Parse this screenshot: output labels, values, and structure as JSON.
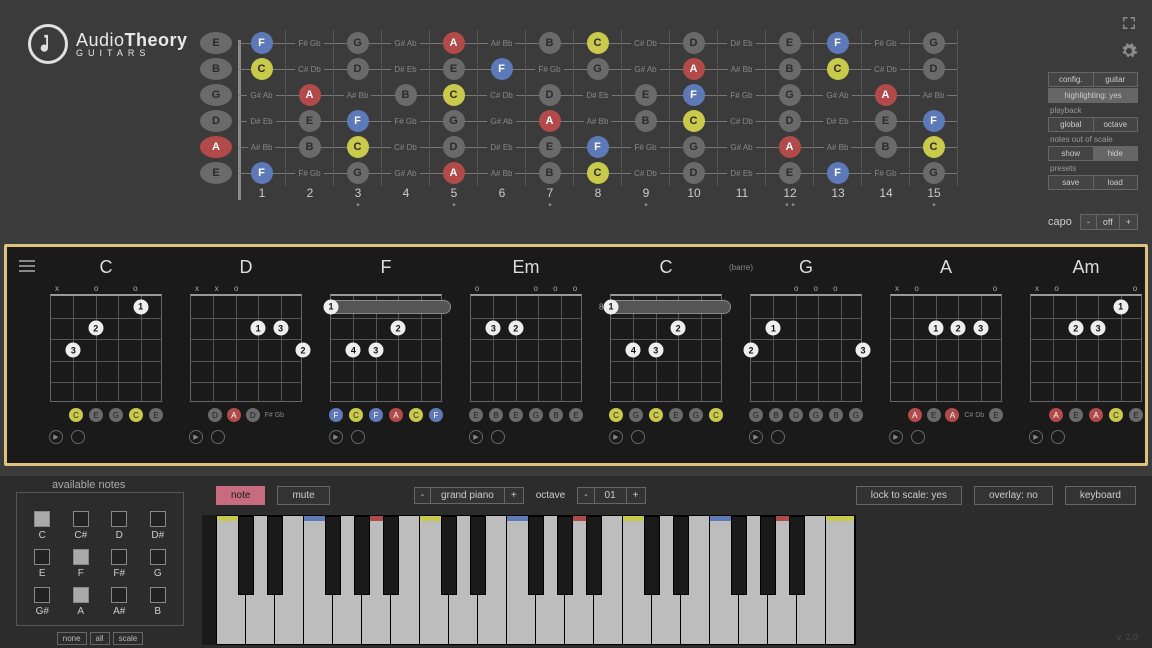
{
  "app": {
    "brand1": "Audio",
    "brand2": "Theory",
    "brand3": "GUITARS"
  },
  "settings": {
    "config": "config.",
    "guitar": "guitar",
    "highlighting": "highlighting: yes",
    "playback_hdr": "playback",
    "global": "global",
    "octave": "octave",
    "oos_hdr": "notes out of scale",
    "show": "show",
    "hide": "hide",
    "presets_hdr": "presets",
    "save": "save",
    "load": "load"
  },
  "capo": {
    "label": "capo",
    "minus": "-",
    "value": "off",
    "plus": "+"
  },
  "tuning": [
    "E",
    "B",
    "G",
    "D",
    "A",
    "E"
  ],
  "fretboard": {
    "frets": [
      "1",
      "2",
      "3",
      "4",
      "5",
      "6",
      "7",
      "8",
      "9",
      "10",
      "11",
      "12",
      "13",
      "14",
      "15"
    ],
    "dots": [
      "",
      "",
      "•",
      "",
      "•",
      "",
      "•",
      "",
      "•",
      "",
      "",
      "• •",
      "",
      "",
      "•"
    ],
    "rows": [
      [
        [
          "F",
          "b"
        ],
        [
          "F# Gb",
          ""
        ],
        [
          "G",
          "g"
        ],
        [
          "G# Ab",
          ""
        ],
        [
          "A",
          "r"
        ],
        [
          "A# Bb",
          ""
        ],
        [
          "B",
          "g"
        ],
        [
          "C",
          "y"
        ],
        [
          "C# Db",
          ""
        ],
        [
          "D",
          "g"
        ],
        [
          "D# Eb",
          ""
        ],
        [
          "E",
          "g"
        ],
        [
          "F",
          "b"
        ],
        [
          "F# Gb",
          ""
        ],
        [
          "G",
          "g"
        ]
      ],
      [
        [
          "C",
          "y"
        ],
        [
          "C# Db",
          ""
        ],
        [
          "D",
          "g"
        ],
        [
          "D# Eb",
          ""
        ],
        [
          "E",
          "g"
        ],
        [
          "F",
          "b"
        ],
        [
          "F# Gb",
          ""
        ],
        [
          "G",
          "g"
        ],
        [
          "G# Ab",
          ""
        ],
        [
          "A",
          "r"
        ],
        [
          "A# Bb",
          ""
        ],
        [
          "B",
          "g"
        ],
        [
          "C",
          "y"
        ],
        [
          "C# Db",
          ""
        ],
        [
          "D",
          "g"
        ]
      ],
      [
        [
          "G# Ab",
          ""
        ],
        [
          "A",
          "r"
        ],
        [
          "A# Bb",
          ""
        ],
        [
          "B",
          "g"
        ],
        [
          "C",
          "y"
        ],
        [
          "C# Db",
          ""
        ],
        [
          "D",
          "g"
        ],
        [
          "D# Eb",
          ""
        ],
        [
          "E",
          "g"
        ],
        [
          "F",
          "b"
        ],
        [
          "F# Gb",
          ""
        ],
        [
          "G",
          "g"
        ],
        [
          "G# Ab",
          ""
        ],
        [
          "A",
          "r"
        ],
        [
          "A# Bb",
          ""
        ]
      ],
      [
        [
          "D# Eb",
          ""
        ],
        [
          "E",
          "g"
        ],
        [
          "F",
          "b"
        ],
        [
          "F# Gb",
          ""
        ],
        [
          "G",
          "g"
        ],
        [
          "G# Ab",
          ""
        ],
        [
          "A",
          "r"
        ],
        [
          "A# Bb",
          ""
        ],
        [
          "B",
          "g"
        ],
        [
          "C",
          "y"
        ],
        [
          "C# Db",
          ""
        ],
        [
          "D",
          "g"
        ],
        [
          "D# Eb",
          ""
        ],
        [
          "E",
          "g"
        ],
        [
          "F",
          "b"
        ]
      ],
      [
        [
          "A# Bb",
          ""
        ],
        [
          "B",
          "g"
        ],
        [
          "C",
          "y"
        ],
        [
          "C# Db",
          ""
        ],
        [
          "D",
          "g"
        ],
        [
          "D# Eb",
          ""
        ],
        [
          "E",
          "g"
        ],
        [
          "F",
          "b"
        ],
        [
          "F# Gb",
          ""
        ],
        [
          "G",
          "g"
        ],
        [
          "G# Ab",
          ""
        ],
        [
          "A",
          "r"
        ],
        [
          "A# Bb",
          ""
        ],
        [
          "B",
          "g"
        ],
        [
          "C",
          "y"
        ]
      ],
      [
        [
          "F",
          "b"
        ],
        [
          "F# Gb",
          ""
        ],
        [
          "G",
          "g"
        ],
        [
          "G# Ab",
          ""
        ],
        [
          "A",
          "r"
        ],
        [
          "A# Bb",
          ""
        ],
        [
          "B",
          "g"
        ],
        [
          "C",
          "y"
        ],
        [
          "C# Db",
          ""
        ],
        [
          "D",
          "g"
        ],
        [
          "D# Eb",
          ""
        ],
        [
          "E",
          "g"
        ],
        [
          "F",
          "b"
        ],
        [
          "F# Gb",
          ""
        ],
        [
          "G",
          "g"
        ]
      ]
    ]
  },
  "chords": [
    {
      "name": "C",
      "open": [
        "x",
        "",
        "o",
        "",
        "o",
        ""
      ],
      "dots": [
        [
          1,
          1,
          "1"
        ],
        [
          3,
          2,
          "2"
        ],
        [
          4,
          3,
          "3"
        ]
      ],
      "tones": [
        [
          "",
          ""
        ],
        [
          "C",
          "y"
        ],
        [
          "E",
          "g"
        ],
        [
          "G",
          "g"
        ],
        [
          "C",
          "y"
        ],
        [
          "E",
          "g"
        ]
      ]
    },
    {
      "name": "D",
      "open": [
        "x",
        "x",
        "o",
        "",
        "",
        ""
      ],
      "dots": [
        [
          2,
          2,
          "1"
        ],
        [
          1,
          2,
          "3"
        ],
        [
          0,
          3,
          "2"
        ]
      ],
      "tones": [
        [
          "",
          ""
        ],
        [
          "D",
          "g"
        ],
        [
          "A",
          "r"
        ],
        [
          "D",
          "g"
        ],
        [
          "F# Gb",
          "t"
        ],
        [
          "",
          ""
        ]
      ]
    },
    {
      "name": "F",
      "open": [
        "",
        "",
        "",
        "",
        "",
        ""
      ],
      "barre": {
        "fret": 1,
        "from": 0,
        "to": 5,
        "label": "1"
      },
      "dots": [
        [
          2,
          2,
          "2"
        ],
        [
          3,
          3,
          "3"
        ],
        [
          4,
          3,
          "4"
        ]
      ],
      "tones": [
        [
          "F",
          "b"
        ],
        [
          "C",
          "y"
        ],
        [
          "F",
          "b"
        ],
        [
          "A",
          "r"
        ],
        [
          "C",
          "y"
        ],
        [
          "F",
          "b"
        ]
      ]
    },
    {
      "name": "Em",
      "open": [
        "o",
        "",
        "",
        "o",
        "o",
        "o"
      ],
      "dots": [
        [
          3,
          2,
          "2"
        ],
        [
          4,
          2,
          "3"
        ]
      ],
      "tones": [
        [
          "E",
          "g"
        ],
        [
          "B",
          "g"
        ],
        [
          "E",
          "g"
        ],
        [
          "G",
          "g"
        ],
        [
          "B",
          "g"
        ],
        [
          "E",
          "g"
        ]
      ]
    },
    {
      "name": "C",
      "sub": "(barre)",
      "open": [
        "",
        "",
        "",
        "",
        "",
        ""
      ],
      "barre": {
        "fret": 1,
        "from": 0,
        "to": 5,
        "label": "1",
        "pos": "8"
      },
      "dots": [
        [
          2,
          2,
          "2"
        ],
        [
          3,
          3,
          "3"
        ],
        [
          4,
          3,
          "4"
        ]
      ],
      "tones": [
        [
          "C",
          "y"
        ],
        [
          "G",
          "g"
        ],
        [
          "C",
          "y"
        ],
        [
          "E",
          "g"
        ],
        [
          "G",
          "g"
        ],
        [
          "C",
          "y"
        ]
      ]
    },
    {
      "name": "G",
      "open": [
        "",
        "",
        "o",
        "o",
        "o",
        ""
      ],
      "dots": [
        [
          4,
          2,
          "1"
        ],
        [
          5,
          3,
          "2"
        ],
        [
          0,
          3,
          "3"
        ]
      ],
      "tones": [
        [
          "G",
          "g"
        ],
        [
          "B",
          "g"
        ],
        [
          "D",
          "g"
        ],
        [
          "G",
          "g"
        ],
        [
          "B",
          "g"
        ],
        [
          "G",
          "g"
        ]
      ]
    },
    {
      "name": "A",
      "open": [
        "x",
        "o",
        "",
        "",
        "",
        "o"
      ],
      "dots": [
        [
          3,
          2,
          "1"
        ],
        [
          2,
          2,
          "2"
        ],
        [
          1,
          2,
          "3"
        ]
      ],
      "tones": [
        [
          "",
          ""
        ],
        [
          "A",
          "r"
        ],
        [
          "E",
          "g"
        ],
        [
          "A",
          "r"
        ],
        [
          "C# Db",
          "t"
        ],
        [
          "E",
          "g"
        ]
      ]
    },
    {
      "name": "Am",
      "open": [
        "x",
        "o",
        "",
        "",
        "",
        "o"
      ],
      "dots": [
        [
          1,
          1,
          "1"
        ],
        [
          3,
          2,
          "2"
        ],
        [
          2,
          2,
          "3"
        ]
      ],
      "tones": [
        [
          "",
          ""
        ],
        [
          "A",
          "r"
        ],
        [
          "E",
          "g"
        ],
        [
          "A",
          "r"
        ],
        [
          "C",
          "y"
        ],
        [
          "E",
          "g"
        ]
      ]
    }
  ],
  "avail": {
    "title": "available notes",
    "notes": [
      [
        "C",
        true
      ],
      [
        "C#",
        false
      ],
      [
        "D",
        false
      ],
      [
        "D#",
        false
      ],
      [
        "E",
        false
      ],
      [
        "F",
        true
      ],
      [
        "F#",
        false
      ],
      [
        "G",
        false
      ],
      [
        "G#",
        false
      ],
      [
        "A",
        true
      ],
      [
        "A#",
        false
      ],
      [
        "B",
        false
      ]
    ],
    "btns": [
      "none",
      "all",
      "scale"
    ]
  },
  "bottom": {
    "note": "note",
    "mute": "mute",
    "instrument": "grand piano",
    "octave_lbl": "octave",
    "octave_val": "01",
    "lock": "lock to scale: yes",
    "overlay": "overlay: no",
    "keyboard": "keyboard"
  },
  "version": "v. 2.0"
}
